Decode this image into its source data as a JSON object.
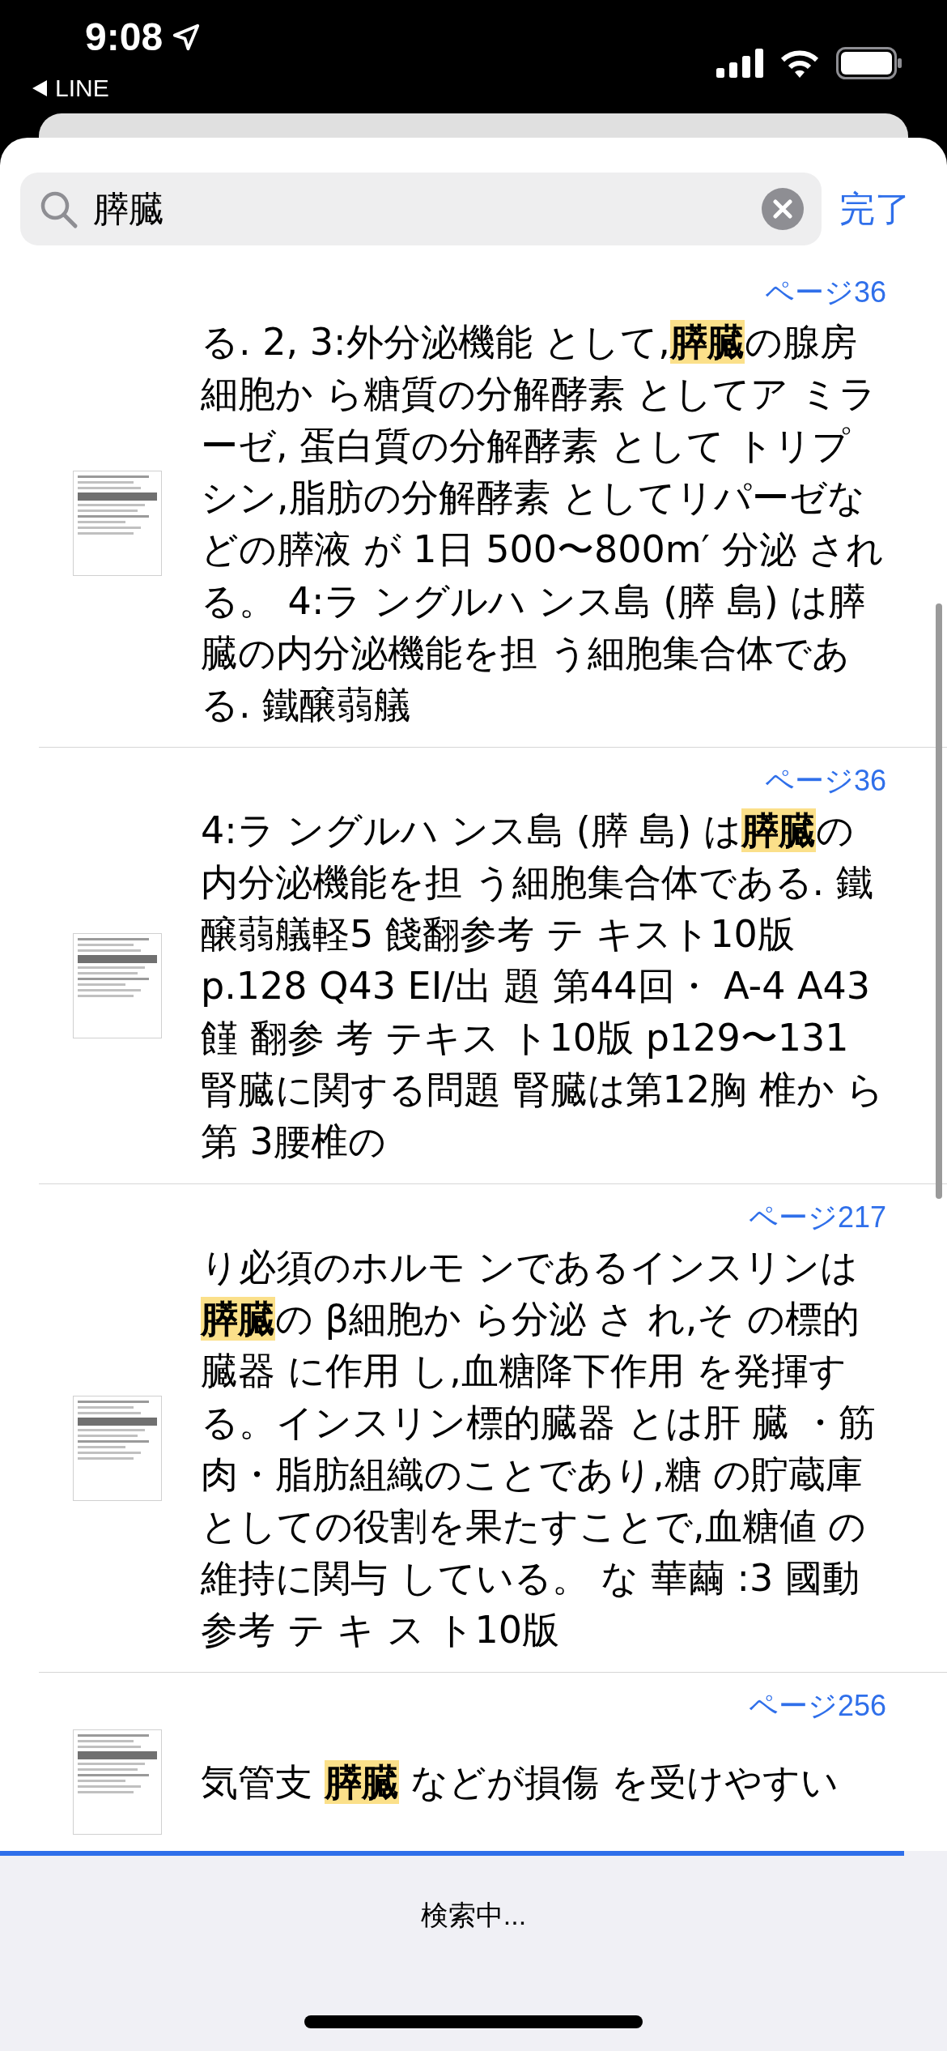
{
  "status_bar": {
    "time": "9:08",
    "back_label": "LINE"
  },
  "search": {
    "value": "膵臓",
    "done_label": "完了"
  },
  "results": [
    {
      "page": "ページ36",
      "before": "る. 2, 3:外分泌機能 として,",
      "match": "膵臓",
      "after": "の腺房細胞か ら糖質の分解酵素 としてア ミラーゼ, 蛋白質の分解酵素 として トリプシン,脂肪の分解酵素 としてリパーゼなどの膵液 が 1日 500〜800m′ 分泌 される。 4:ラ ングルハ ンス島 (膵 島) は膵臓の内分泌機能を担 う細胞集合体である. 鐵醸蒻艤"
    },
    {
      "page": "ページ36",
      "before": "4:ラ ングルハ ンス島 (膵 島) は",
      "match": "膵臓",
      "after": "の内分泌機能を担 う細胞集合体である. 鐵醸蒻艤軽5 餞翻参考 テ キスト10版 p.128 Q43 EI/出 題 第44回・ A-4 A43 饉 翻参 考 テキス ト10版 p129〜131 腎臓に関する問題 腎臓は第12胸 椎か ら第 3腰椎の"
    },
    {
      "page": "ページ217",
      "before": "り必須のホルモ ンであるインスリンは",
      "match": "膵臓",
      "after": "の β細胞か ら分泌 さ れ,そ の標的臓器 に作用 し,血糖降下作用 を発揮する。インスリン標的臓器 とは肝 臓 ・筋肉・脂肪組織のことであり,糖 の貯蔵庫としての役割を果たすことで,血糖値 の維持に関与 している。 な 華繭 :3 國動参考 テ キ ス ト10版"
    },
    {
      "page": "ページ256",
      "before": "気管支 ",
      "match": "膵臓",
      "after": " などが損傷 を受けやすい"
    }
  ],
  "footer": {
    "text": "検索中...",
    "level": 0.955
  }
}
